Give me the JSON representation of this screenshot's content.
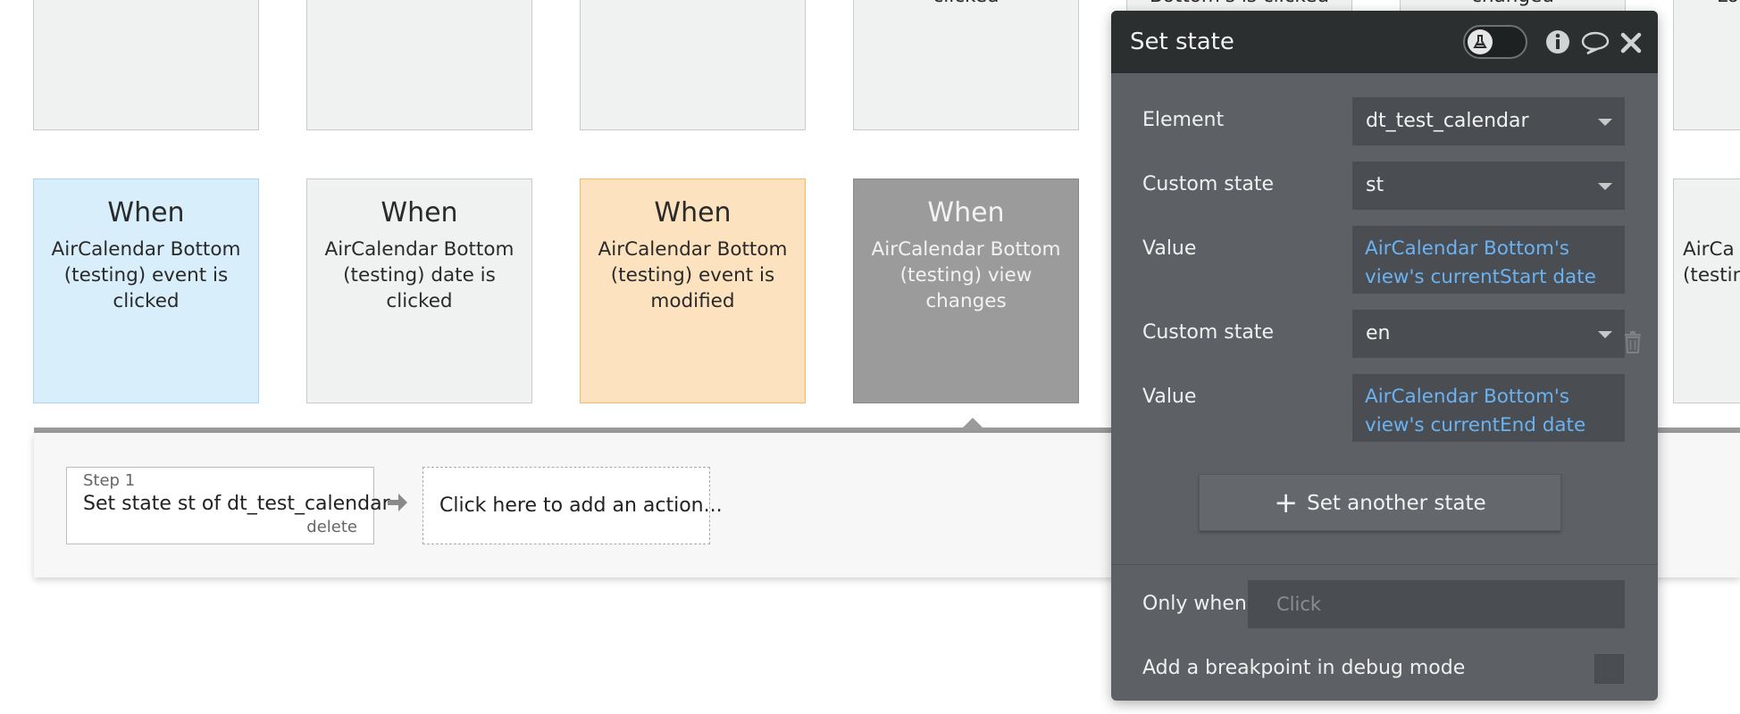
{
  "canvas": {
    "top_row": [
      {
        "text": ""
      },
      {
        "text": ""
      },
      {
        "text": ""
      },
      {
        "text": "clicked"
      },
      {
        "text": "Bottom's is clicked"
      },
      {
        "text": "changed"
      },
      {
        "text": "Lo"
      }
    ],
    "cards": [
      {
        "when": "When",
        "desc": "AirCalendar Bottom (testing) event is clicked"
      },
      {
        "when": "When",
        "desc": "AirCalendar Bottom (testing) date is clicked"
      },
      {
        "when": "When",
        "desc": "AirCalendar Bottom (testing) event is modified"
      },
      {
        "when": "When",
        "desc": "AirCalendar Bottom (testing) view changes"
      },
      {
        "when": "",
        "desc": "AirCa (testin"
      }
    ],
    "colors": {
      "blue": "#d8eefb",
      "orange": "#fde2bf",
      "gray_selected": "#9b9b9b"
    }
  },
  "workflow": {
    "step": {
      "number": "Step 1",
      "title": "Set state st of dt_test_calendar",
      "delete": "delete"
    },
    "add_action": "Click here to add an action...",
    "arrow_icon": "arrow-right-icon"
  },
  "dialog": {
    "title": "Set state",
    "icons": [
      "flask-icon",
      "info-icon",
      "comment-icon",
      "close-icon"
    ],
    "element_label": "Element",
    "element_value": "dt_test_calendar",
    "state1_label": "Custom state",
    "state1_value": "st",
    "value1_label": "Value",
    "value1": "AirCalendar Bottom's view's currentStart date",
    "state2_label": "Custom state",
    "state2_value": "en",
    "value2_label": "Value",
    "value2": "AirCalendar Bottom's view's currentEnd date",
    "another_button": "Set another state",
    "only_when_label": "Only when",
    "only_when_placeholder": "Click",
    "breakpoint_label": "Add a breakpoint in debug mode",
    "link_color": "#6ab2f2"
  }
}
